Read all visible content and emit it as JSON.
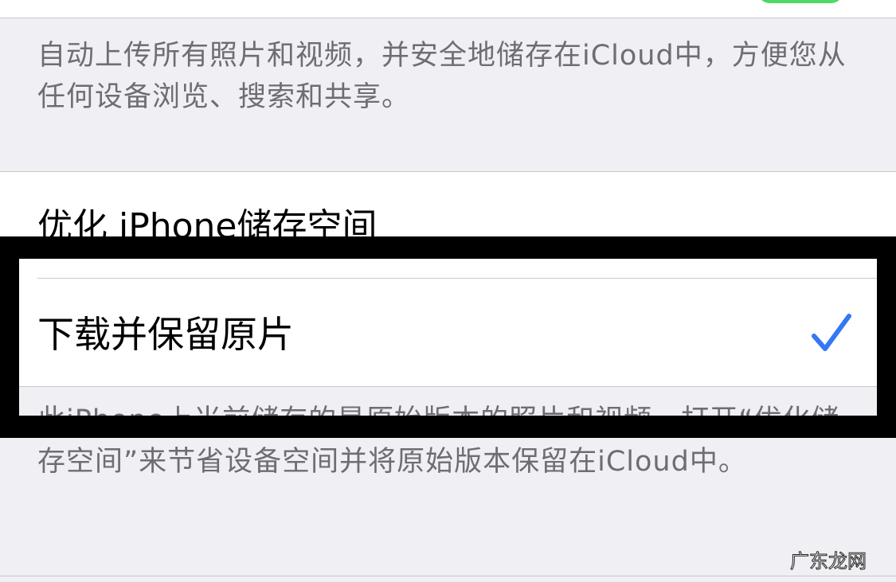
{
  "top_description": "自动上传所有照片和视频，并安全地储存在iCloud中，方便您从任何设备浏览、搜索和共享。",
  "options": {
    "optimize_label": "优化 iPhone储存空间",
    "download_label": "下载并保留原片"
  },
  "bottom_description": "此iPhone上当前储存的是原始版本的照片和视频。打开“优化储存空间”来节省设备空间并将原始版本保留在iCloud中。",
  "watermark_text": "广东龙网",
  "colors": {
    "background": "#efeff4",
    "cell": "#ffffff",
    "separator": "#c8c7cc",
    "secondary_text": "#6d6d72",
    "checkmark": "#3478f6",
    "toggle_on": "#4cd964",
    "annotation_frame": "#000000"
  },
  "icons": {
    "selected": "checkmark-icon"
  }
}
